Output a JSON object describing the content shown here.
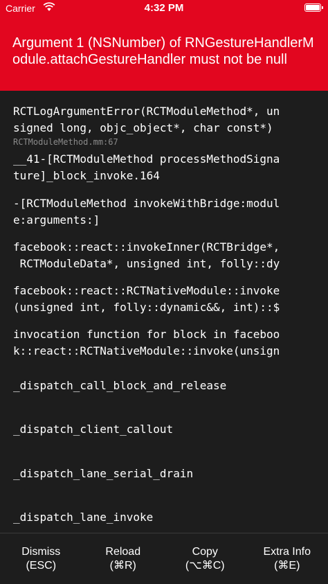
{
  "status_bar": {
    "carrier": "Carrier",
    "time": "4:32 PM"
  },
  "error": {
    "message": "Argument 1 (NSNumber) of RNGestureHandlerModule.attachGestureHandler must not be null"
  },
  "stack": [
    {
      "lines": [
        "RCTLogArgumentError(RCTModuleMethod*, un",
        "signed long, objc_object*, char const*)"
      ],
      "location": "RCTModuleMethod.mm:67"
    },
    {
      "lines": [
        "__41-[RCTModuleMethod processMethodSigna",
        "ture]_block_invoke.164"
      ]
    },
    {
      "lines": [
        "-[RCTModuleMethod invokeWithBridge:modul",
        "e:arguments:]"
      ]
    },
    {
      "lines": [
        "facebook::react::invokeInner(RCTBridge*,",
        " RCTModuleData*, unsigned int, folly::dy"
      ]
    },
    {
      "lines": [
        "facebook::react::RCTNativeModule::invoke",
        "(unsigned int, folly::dynamic&&, int)::$"
      ]
    },
    {
      "lines": [
        "invocation function for block in faceboo",
        "k::react::RCTNativeModule::invoke(unsign"
      ]
    },
    {
      "lines": [
        "_dispatch_call_block_and_release"
      ]
    },
    {
      "lines": [
        "_dispatch_client_callout"
      ]
    },
    {
      "lines": [
        "_dispatch_lane_serial_drain"
      ]
    },
    {
      "lines": [
        "_dispatch_lane_invoke"
      ]
    }
  ],
  "buttons": [
    {
      "label": "Dismiss",
      "shortcut": "(ESC)"
    },
    {
      "label": "Reload",
      "shortcut": "(⌘R)"
    },
    {
      "label": "Copy",
      "shortcut": "(⌥⌘C)"
    },
    {
      "label": "Extra Info",
      "shortcut": "(⌘E)"
    }
  ],
  "colors": {
    "header_red": "#e2061f",
    "background": "#1d1d1d",
    "location_gray": "#8a8a8a"
  }
}
